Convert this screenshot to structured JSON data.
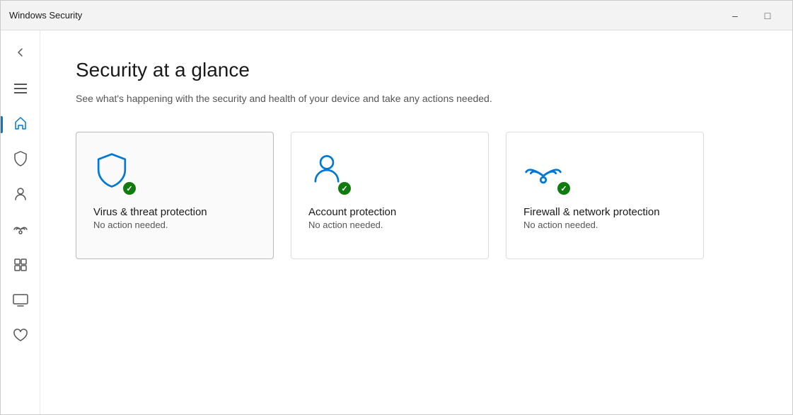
{
  "titleBar": {
    "title": "Windows Security",
    "minimizeLabel": "–",
    "maximizeLabel": "□"
  },
  "sidebar": {
    "items": [
      {
        "id": "back",
        "icon": "←",
        "label": "Back"
      },
      {
        "id": "menu",
        "icon": "☰",
        "label": "Menu"
      },
      {
        "id": "home",
        "icon": "⌂",
        "label": "Home",
        "active": true
      },
      {
        "id": "shield",
        "icon": "🛡",
        "label": "Virus & threat protection"
      },
      {
        "id": "person",
        "icon": "👤",
        "label": "Account protection"
      },
      {
        "id": "wifi",
        "icon": "📶",
        "label": "Firewall & network protection"
      },
      {
        "id": "box",
        "icon": "▣",
        "label": "App & browser control"
      },
      {
        "id": "device",
        "icon": "🖥",
        "label": "Device security"
      },
      {
        "id": "health",
        "icon": "♡",
        "label": "Device performance & health"
      }
    ]
  },
  "content": {
    "title": "Security at a glance",
    "subtitle": "See what's happening with the security and health of your device and take any actions needed.",
    "cards": [
      {
        "id": "virus",
        "label": "Virus & threat protection",
        "status": "No action needed.",
        "selected": true
      },
      {
        "id": "account",
        "label": "Account protection",
        "status": "No action needed.",
        "selected": false
      },
      {
        "id": "firewall",
        "label": "Firewall & network protection",
        "status": "No action needed.",
        "selected": false
      }
    ]
  }
}
